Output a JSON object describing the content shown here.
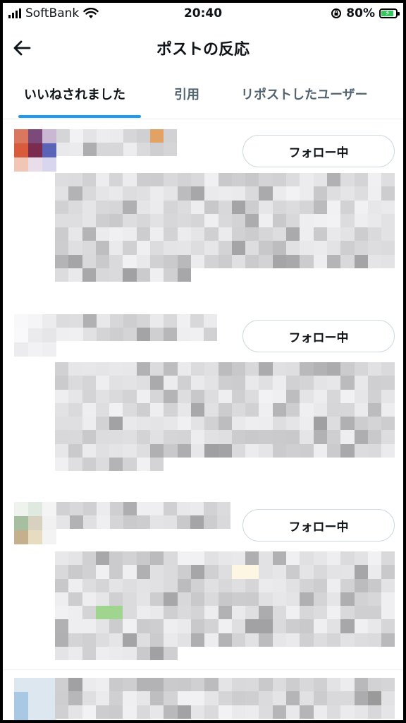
{
  "status_bar": {
    "carrier": "SoftBank",
    "time": "20:40",
    "battery_percent": "80%",
    "battery_level": 0.8,
    "battery_color": "#34c759",
    "icons": [
      "signal-icon",
      "wifi-icon",
      "rotation-lock-icon",
      "battery-charging-icon"
    ]
  },
  "header": {
    "title": "ポストの反応",
    "back_icon": "arrow-left-icon"
  },
  "tabs": [
    {
      "label": "いいねされました",
      "active": true
    },
    {
      "label": "引用",
      "active": false
    },
    {
      "label": "リポストしたユーザー",
      "active": false
    }
  ],
  "accent_color": "#1d9bf0",
  "users": [
    {
      "follow_label": "フォロー中",
      "content": "pixelated"
    },
    {
      "follow_label": "フォロー中",
      "content": "pixelated"
    },
    {
      "follow_label": "フォロー中",
      "content": "pixelated"
    }
  ]
}
